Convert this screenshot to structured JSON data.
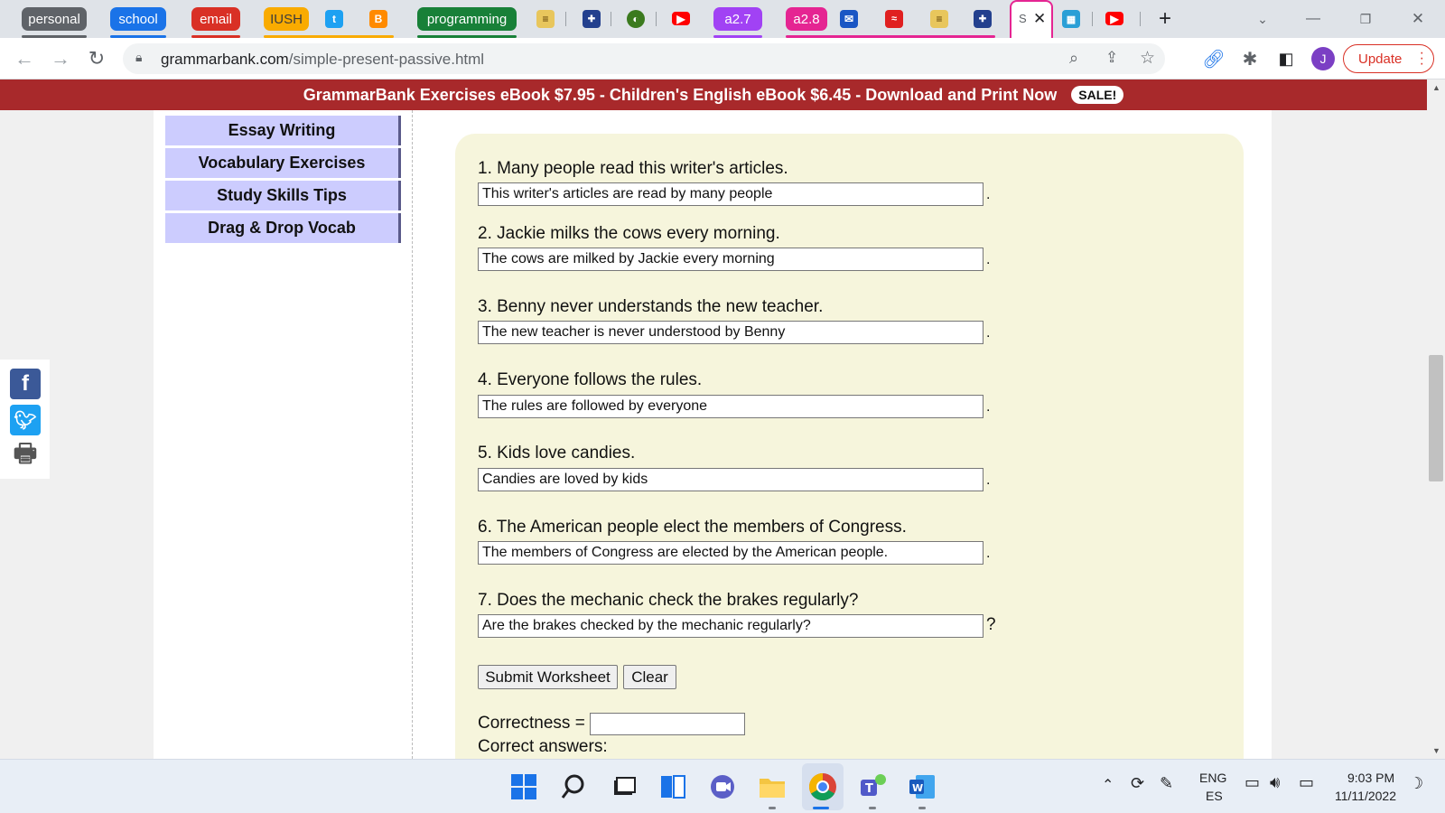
{
  "browser": {
    "tab_groups": [
      {
        "label": "personal",
        "color": "#5f6368"
      },
      {
        "label": "school",
        "color": "#1a73e8"
      },
      {
        "label": "email",
        "color": "#d93025"
      },
      {
        "label": "IUSH",
        "color": "#f9ab00"
      },
      {
        "label": "programming",
        "color": "#188038"
      },
      {
        "label": "a2.7",
        "color": "#a142f4"
      },
      {
        "label": "a2.8",
        "color": "#e52592"
      }
    ],
    "active_tab_label": "S",
    "url_domain": "grammarbank.com",
    "url_path": "/simple-present-passive.html",
    "update_label": "Update",
    "profile_initial": "J"
  },
  "banner": {
    "text": "GrammarBank Exercises eBook $7.95 - Children's English eBook $6.45 - Download and Print Now",
    "badge": "SALE!",
    "background": "#a8292b"
  },
  "sidebar": {
    "items": [
      {
        "label": "Essay Writing"
      },
      {
        "label": "Vocabulary Exercises"
      },
      {
        "label": "Study Skills Tips"
      },
      {
        "label": "Drag & Drop Vocab"
      }
    ]
  },
  "worksheet": {
    "questions": [
      {
        "prompt": "1. Many people read this writer's articles.",
        "answer": "This writer's articles are read by many people",
        "end": "."
      },
      {
        "prompt": "2. Jackie milks the cows every morning.",
        "answer": "The cows are milked by Jackie every morning",
        "end": "."
      },
      {
        "prompt": "3. Benny never understands the new teacher.",
        "answer": "The new teacher is never understood by Benny",
        "end": "."
      },
      {
        "prompt": "4. Everyone follows the rules.",
        "answer": "The rules are followed by everyone",
        "end": "."
      },
      {
        "prompt": "5. Kids love candies.",
        "answer": "Candies are loved by kids",
        "end": "."
      },
      {
        "prompt": "6. The American people elect the members of Congress.",
        "answer": "The members of Congress are elected by the American people.",
        "end": "."
      },
      {
        "prompt": "7. Does the mechanic check the brakes regularly?",
        "answer": "Are the brakes checked by the mechanic regularly?",
        "end": "?"
      }
    ],
    "submit_label": "Submit Worksheet",
    "clear_label": "Clear",
    "correctness_label": "Correctness =",
    "correctness_value": "",
    "correct_answers_label": "Correct answers:"
  },
  "taskbar": {
    "language": "ENG",
    "layout": "ES",
    "time": "9:03 PM",
    "date": "11/11/2022"
  }
}
